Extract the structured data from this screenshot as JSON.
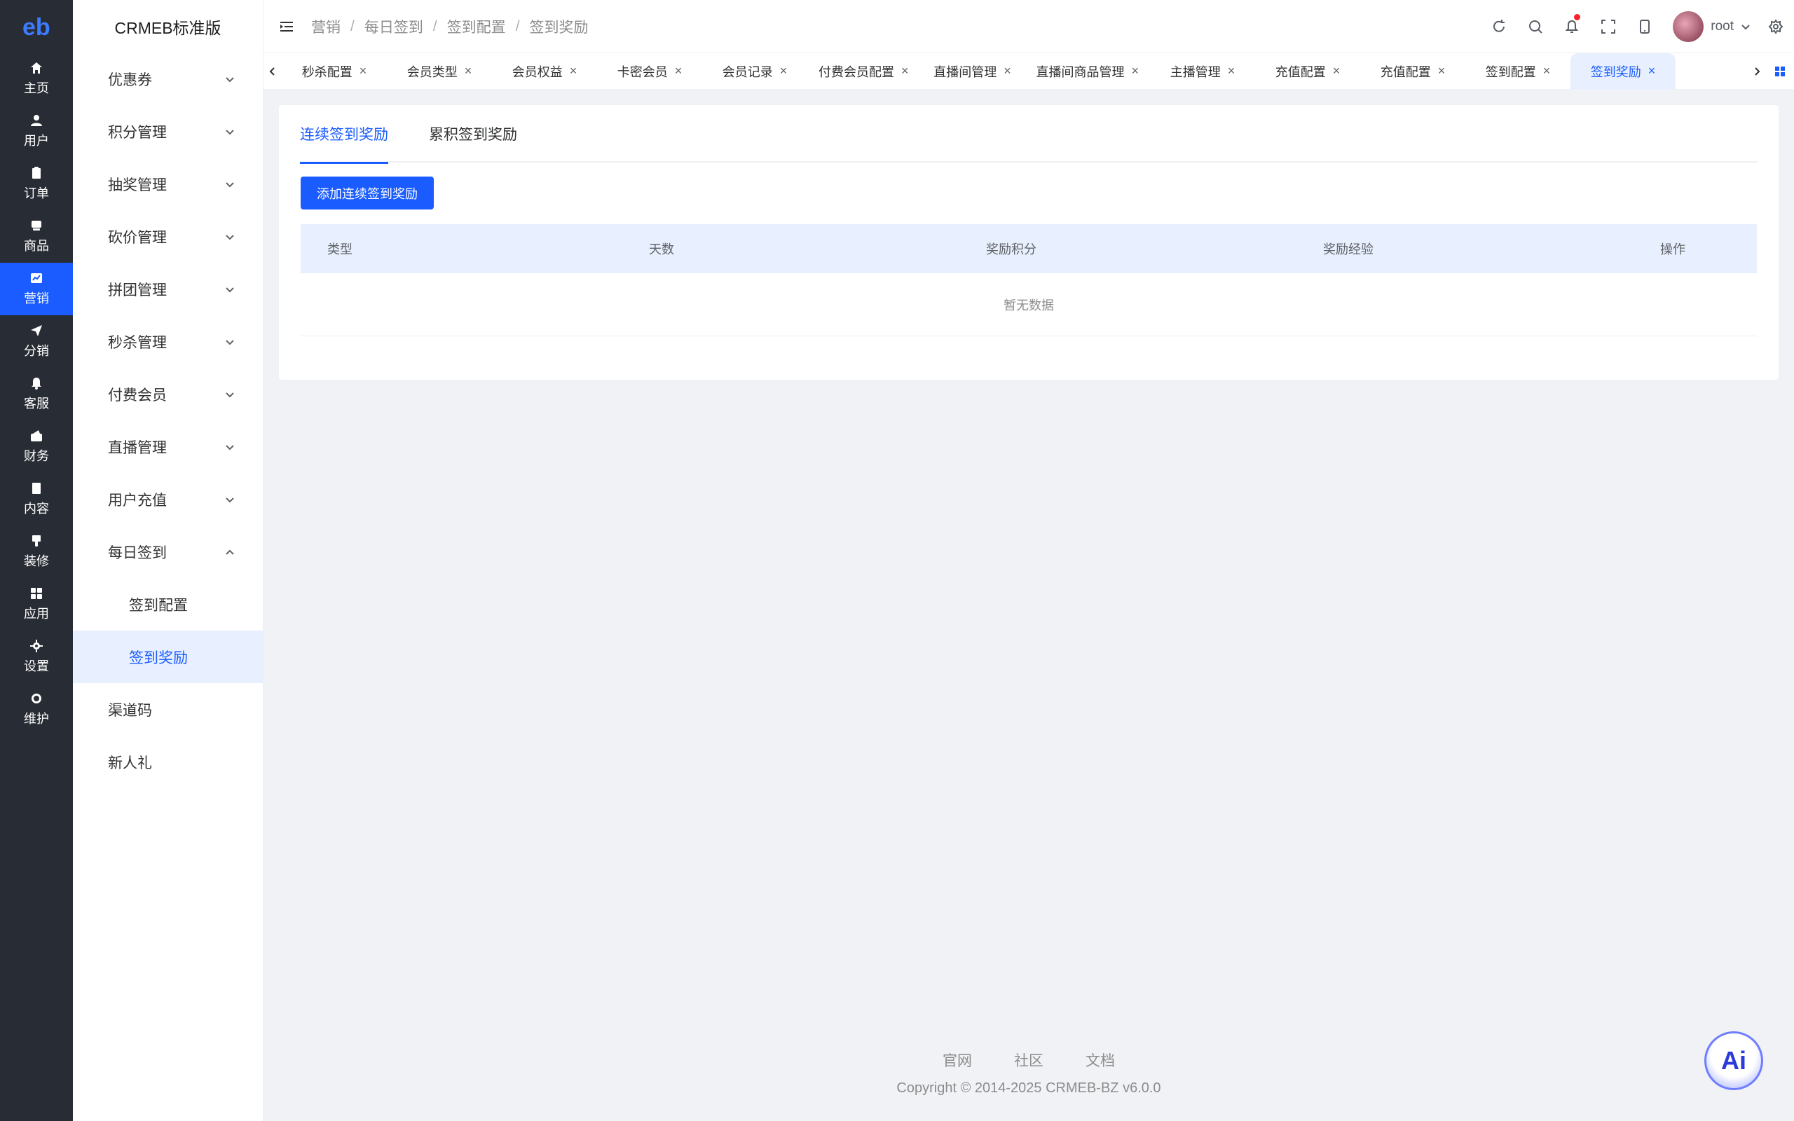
{
  "brand": {
    "logo_text": "eb",
    "app_title": "CRMEB标准版"
  },
  "rail": {
    "items": [
      {
        "label": "主页",
        "icon": "home-icon"
      },
      {
        "label": "用户",
        "icon": "user-icon"
      },
      {
        "label": "订单",
        "icon": "order-icon"
      },
      {
        "label": "商品",
        "icon": "product-icon"
      },
      {
        "label": "营销",
        "icon": "marketing-icon"
      },
      {
        "label": "分销",
        "icon": "send-icon"
      },
      {
        "label": "客服",
        "icon": "bell-icon"
      },
      {
        "label": "财务",
        "icon": "finance-icon"
      },
      {
        "label": "内容",
        "icon": "book-icon"
      },
      {
        "label": "装修",
        "icon": "brush-icon"
      },
      {
        "label": "应用",
        "icon": "grid-icon"
      },
      {
        "label": "设置",
        "icon": "gear-icon"
      },
      {
        "label": "维护",
        "icon": "chip-icon"
      }
    ],
    "active_index": 4
  },
  "menu": {
    "items": [
      {
        "label": "优惠券"
      },
      {
        "label": "积分管理"
      },
      {
        "label": "抽奖管理"
      },
      {
        "label": "砍价管理"
      },
      {
        "label": "拼团管理"
      },
      {
        "label": "秒杀管理"
      },
      {
        "label": "付费会员"
      },
      {
        "label": "直播管理"
      },
      {
        "label": "用户充值"
      },
      {
        "label": "每日签到"
      }
    ],
    "sub_items": [
      {
        "label": "签到配置"
      },
      {
        "label": "签到奖励"
      }
    ],
    "tail_items": [
      {
        "label": "渠道码"
      },
      {
        "label": "新人礼"
      }
    ]
  },
  "breadcrumb": [
    "营销",
    "每日签到",
    "签到配置",
    "签到奖励"
  ],
  "header": {
    "username": "root"
  },
  "tabs": [
    {
      "label": "秒杀配置"
    },
    {
      "label": "会员类型"
    },
    {
      "label": "会员权益"
    },
    {
      "label": "卡密会员"
    },
    {
      "label": "会员记录"
    },
    {
      "label": "付费会员配置"
    },
    {
      "label": "直播间管理"
    },
    {
      "label": "直播间商品管理"
    },
    {
      "label": "主播管理"
    },
    {
      "label": "充值配置"
    },
    {
      "label": "充值配置"
    },
    {
      "label": "签到配置"
    },
    {
      "label": "签到奖励"
    }
  ],
  "content": {
    "tabs": [
      {
        "label": "连续签到奖励"
      },
      {
        "label": "累积签到奖励"
      }
    ],
    "add_button": "添加连续签到奖励",
    "columns": [
      "类型",
      "天数",
      "奖励积分",
      "奖励经验",
      "操作"
    ],
    "empty_text": "暂无数据"
  },
  "footer": {
    "links": [
      "官网",
      "社区",
      "文档"
    ],
    "copyright": "Copyright © 2014-2025 CRMEB-BZ v6.0.0"
  },
  "ai_button": "Ai",
  "colors": {
    "primary": "#1a5cff",
    "rail_bg": "#282c34",
    "active_bg": "#e8f0ff",
    "notify_dot": "#f5222d"
  }
}
